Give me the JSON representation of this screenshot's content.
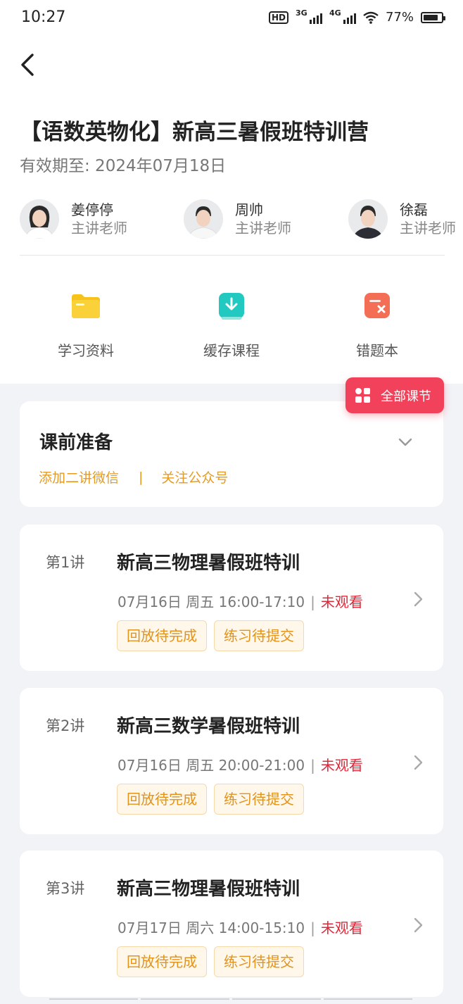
{
  "status_bar": {
    "time": "10:27",
    "hd": "HD",
    "net1": "3G",
    "net2": "4G",
    "battery": "77%"
  },
  "header": {
    "title": "【语数英物化】新高三暑假班特训营",
    "validity": "有效期至: 2024年07月18日"
  },
  "teachers": [
    {
      "name": "姜停停",
      "role": "主讲老师"
    },
    {
      "name": "周帅",
      "role": "主讲老师"
    },
    {
      "name": "徐磊",
      "role": "主讲老师"
    }
  ],
  "tools": [
    {
      "label": "学习资料",
      "icon": "folder-icon",
      "color": "#f7c21a"
    },
    {
      "label": "缓存课程",
      "icon": "download-icon",
      "color": "#21c9c0"
    },
    {
      "label": "错题本",
      "icon": "wrong-book-icon",
      "color": "#f46e55"
    }
  ],
  "floating_button": {
    "label": "全部课节",
    "color": "#f2415a"
  },
  "prep": {
    "title": "课前准备",
    "link1": "添加二讲微信",
    "separator": "|",
    "link2": "关注公众号"
  },
  "lessons": [
    {
      "num": "第1讲",
      "title": "新高三物理暑假班特训",
      "time": "07月16日 周五 16:00-17:10",
      "bar": "|",
      "status": "未观看",
      "tag1": "回放待完成",
      "tag2": "练习待提交"
    },
    {
      "num": "第2讲",
      "title": "新高三数学暑假班特训",
      "time": "07月16日 周五 20:00-21:00",
      "bar": "|",
      "status": "未观看",
      "tag1": "回放待完成",
      "tag2": "练习待提交"
    },
    {
      "num": "第3讲",
      "title": "新高三物理暑假班特训",
      "time": "07月17日 周六 14:00-15:10",
      "bar": "|",
      "status": "未观看",
      "tag1": "回放待完成",
      "tag2": "练习待提交"
    }
  ],
  "colors": {
    "accent_red": "#f2415a",
    "status_red": "#e0283a",
    "tag_orange": "#e3921a"
  }
}
